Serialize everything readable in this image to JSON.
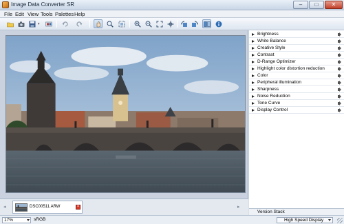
{
  "window": {
    "title": "Image Data Converter SR",
    "minimize": "–",
    "maximize": "□",
    "close": "✕"
  },
  "menu": [
    "File",
    "Edit",
    "View",
    "Tools",
    "Palettes",
    "Help"
  ],
  "toolbar": {
    "icons": [
      "open-folder-icon",
      "camera-icon",
      "save-icon",
      "save-dropdown-icon",
      "batch-process-icon",
      "undo-icon",
      "redo-icon",
      "hand-tool-icon",
      "zoom-tool-icon",
      "crop-icon",
      "zoom-in-icon",
      "zoom-out-icon",
      "fit-icon",
      "actual-size-icon",
      "rotate-left-icon",
      "rotate-right-icon",
      "compare-icon",
      "info-icon"
    ]
  },
  "palettes": [
    {
      "label": "Brightness"
    },
    {
      "label": "White Balance"
    },
    {
      "label": "Creative Style"
    },
    {
      "label": "Contrast"
    },
    {
      "label": "D-Range Optimizer"
    },
    {
      "label": "Highlight color distortion reduction"
    },
    {
      "label": "Color"
    },
    {
      "label": "Peripheral illumination"
    },
    {
      "label": "Sharpness"
    },
    {
      "label": "Noise Reduction"
    },
    {
      "label": "Tone Curve"
    },
    {
      "label": "Display Control"
    }
  ],
  "version_stack": {
    "label": "Version Stack"
  },
  "thumbnails": [
    {
      "filename": "DSC00511.ARW",
      "delete": "×"
    }
  ],
  "strip_nav": {
    "prev": "◂",
    "next": "▸"
  },
  "status": {
    "zoom": "17%",
    "color_space": "sRGB",
    "display_mode": "High Speed Display"
  },
  "colors": {
    "sky_top": "#7fa3c9",
    "sky_bottom": "#c8d7e6",
    "water": "#3f4a52",
    "stone": "#4a4440",
    "roof_red": "#a65a3f",
    "accent_active": "#b7cce4"
  }
}
